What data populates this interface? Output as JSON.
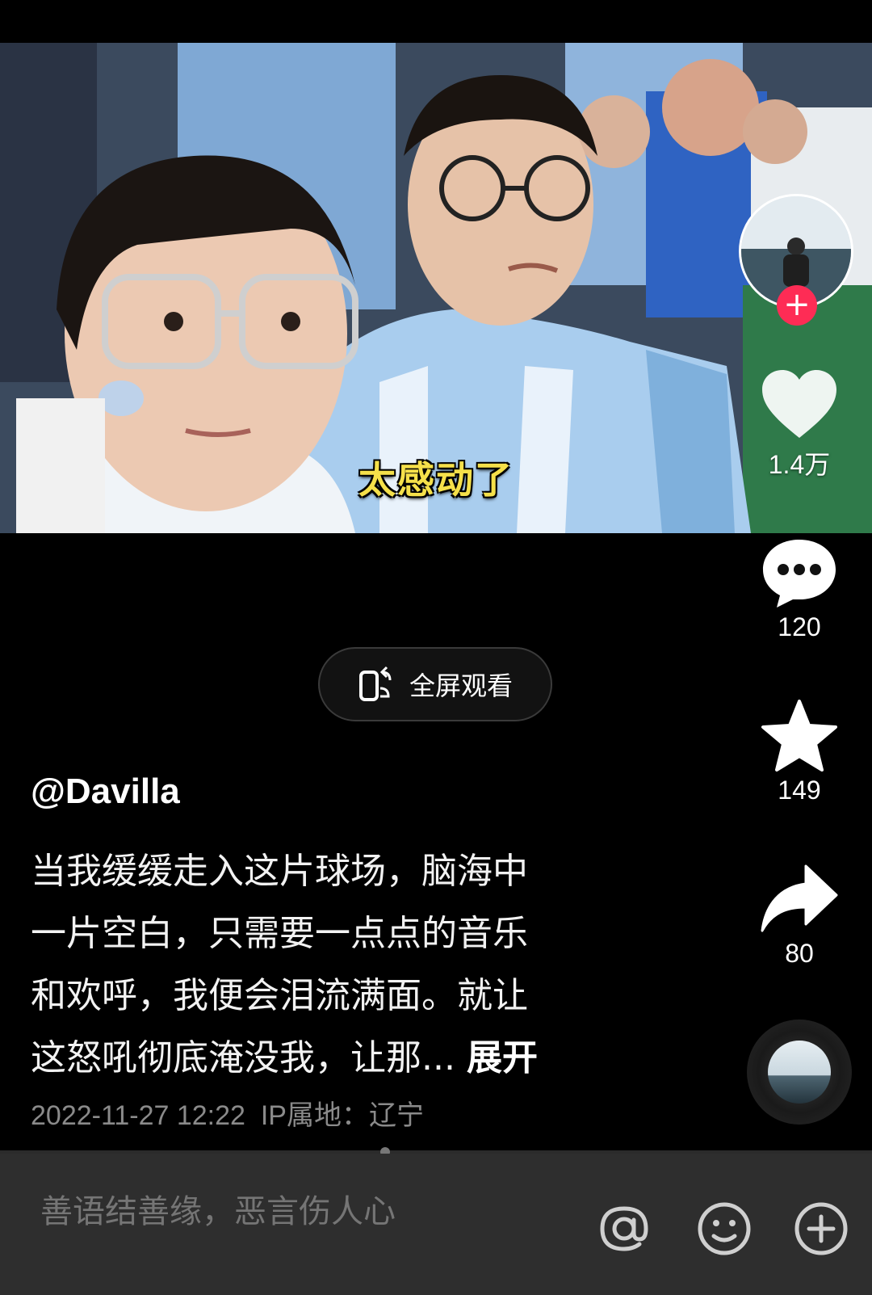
{
  "video": {
    "subtitle": "太感动了"
  },
  "rail": {
    "likes": "1.4万",
    "comments": "120",
    "favorites": "149",
    "shares": "80"
  },
  "fullscreen_label": "全屏观看",
  "post": {
    "author": "@Davilla",
    "description_lines": [
      "当我缓缓走入这片球场，脑海中",
      "一片空白，只需要一点点的音乐",
      "和欢呼，我便会泪流满面。就让",
      "这怒吼彻底淹没我，让那..."
    ],
    "expand_label": "展开",
    "timestamp": "2022-11-27 12:22",
    "ip_location": "IP属地：辽宁"
  },
  "comment_bar": {
    "placeholder": "善语结善缘，恶言伤人心"
  },
  "icons": {
    "like": "heart-icon",
    "comment": "comment-bubble-icon",
    "favorite": "star-icon",
    "share": "share-arrow-icon",
    "mention": "at-icon",
    "emoji": "emoji-icon",
    "add": "plus-circle-icon"
  },
  "colors": {
    "follow_red": "#fe2c55",
    "subtitle_yellow": "#f5e04a"
  }
}
